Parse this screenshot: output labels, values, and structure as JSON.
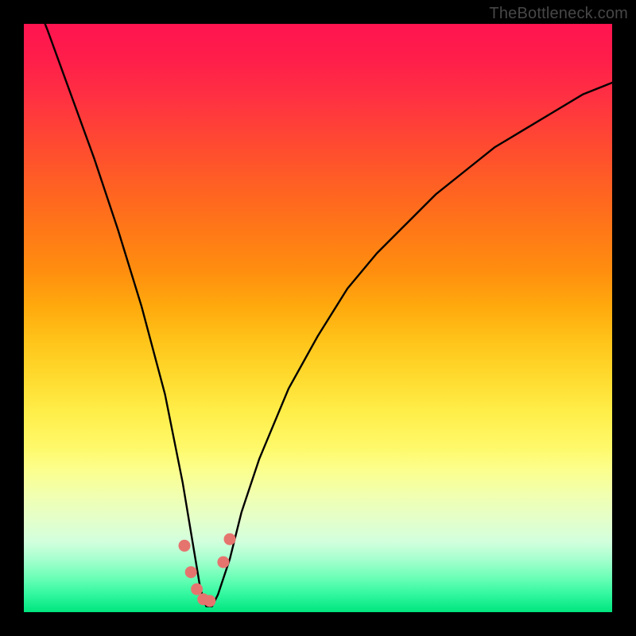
{
  "watermark": "TheBottleneck.com",
  "colors": {
    "frame": "#000000",
    "curve_stroke": "#000000",
    "marker_fill": "#e6746e",
    "gradient_top": "#ff1450",
    "gradient_bottom": "#00e57e"
  },
  "chart_data": {
    "type": "line",
    "title": "",
    "xlabel": "",
    "ylabel": "",
    "xlim": [
      0,
      100
    ],
    "ylim": [
      0,
      100
    ],
    "note": "V-shaped bottleneck curve; y is bottleneck percentage (0 = ideal, green band at bottom). Minimum of curve near x≈31. Values estimated from pixel positions (no axis ticks or labels present).",
    "series": [
      {
        "name": "bottleneck-curve",
        "x": [
          0,
          4,
          8,
          12,
          16,
          20,
          24,
          27,
          29,
          30,
          31,
          32,
          33,
          35,
          37,
          40,
          45,
          50,
          55,
          60,
          65,
          70,
          75,
          80,
          85,
          90,
          95,
          100
        ],
        "y": [
          109,
          99,
          88,
          77,
          65,
          52,
          37,
          22,
          10,
          4,
          1,
          1,
          3,
          9,
          17,
          26,
          38,
          47,
          55,
          61,
          66,
          71,
          75,
          79,
          82,
          85,
          88,
          90
        ]
      }
    ],
    "markers": {
      "name": "highlighted-points",
      "x": [
        27.3,
        28.4,
        29.4,
        30.5,
        31.6,
        33.9,
        35.0
      ],
      "y": [
        11.3,
        6.8,
        3.9,
        2.2,
        1.9,
        8.5,
        12.4
      ]
    }
  }
}
